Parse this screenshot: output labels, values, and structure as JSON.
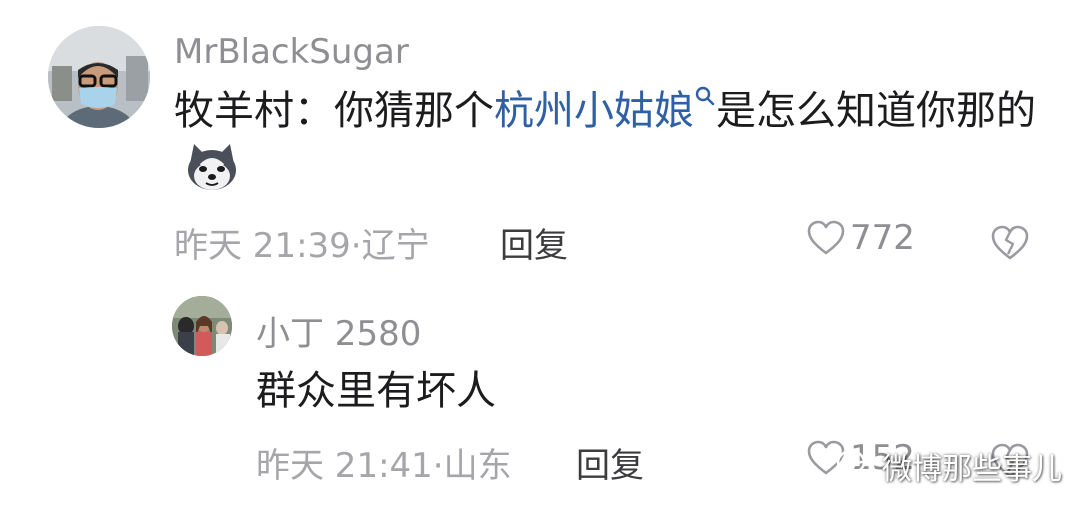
{
  "comment": {
    "username": "MrBlackSugar",
    "text_prefix": "牧羊村：你猜那个",
    "link_text": "杭州小姑娘",
    "text_suffix": "是怎么知道你那的",
    "time": "昨天 21:39",
    "location": "辽宁",
    "reply_label": "回复",
    "like_count": "772",
    "emoji_icon": "husky-dog-emoji"
  },
  "reply": {
    "username": "小丁 2580",
    "text": "群众里有坏人",
    "time": "昨天 21:41",
    "location": "山东",
    "reply_label": "回复",
    "like_count": "152"
  },
  "watermark": {
    "text": "微博那些事儿"
  },
  "colors": {
    "link": "#2f5fa5",
    "meta": "#a5a5aa",
    "text": "#1c1c1e"
  }
}
